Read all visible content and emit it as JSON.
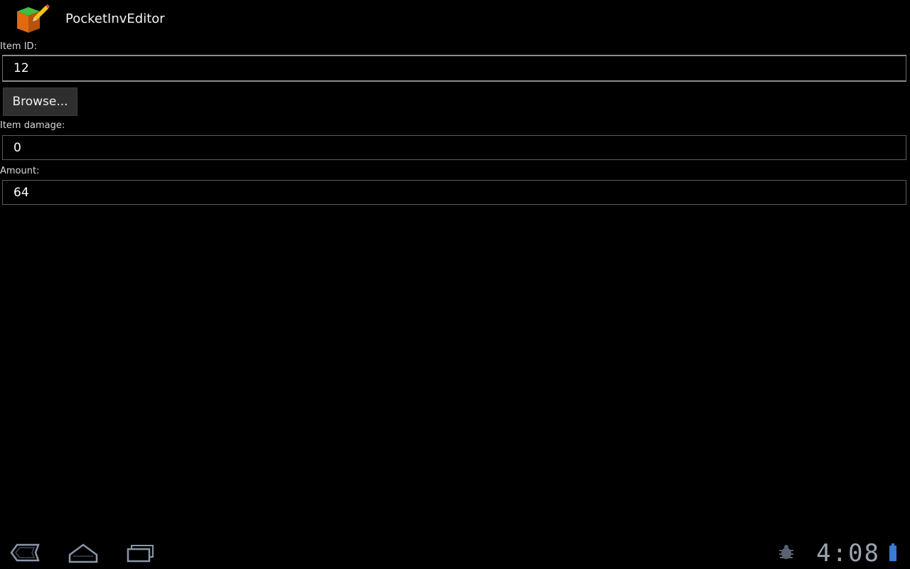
{
  "app": {
    "title": "PocketInvEditor",
    "icon": "app-cube-pencil-icon"
  },
  "form": {
    "item_id": {
      "label": "Item ID:",
      "value": "12"
    },
    "browse_button_label": "Browse...",
    "item_damage": {
      "label": "Item damage:",
      "value": "0"
    },
    "amount": {
      "label": "Amount:",
      "value": "64"
    }
  },
  "system_bar": {
    "nav": [
      "back-icon",
      "home-icon",
      "recent-apps-icon"
    ],
    "status_icons": [
      "android-debug-icon",
      "battery-icon"
    ],
    "clock": "4:08"
  },
  "colors": {
    "background": "#000000",
    "accent_battery": "#3a7bd5",
    "clock": "#9aa4b2"
  }
}
